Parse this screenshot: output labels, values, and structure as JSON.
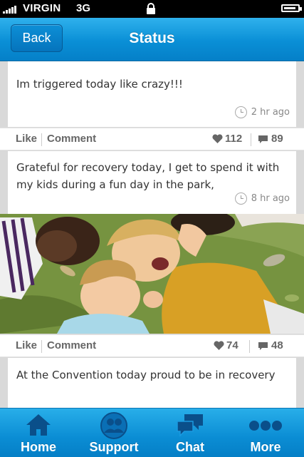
{
  "status_bar": {
    "carrier": "VIRGIN",
    "network": "3G",
    "battery_level": 0.9
  },
  "nav": {
    "back_label": "Back",
    "title": "Status"
  },
  "posts": [
    {
      "text": "Im triggered today like crazy!!!",
      "time": "2 hr ago",
      "like_label": "Like",
      "comment_label": "Comment",
      "likes": "112",
      "comments": "89"
    },
    {
      "text": "Grateful for recovery today, I get to spend it with my kids during a fun day in the park,",
      "time": "8 hr ago",
      "like_label": "Like",
      "comment_label": "Comment",
      "likes": "74",
      "comments": "48"
    },
    {
      "text": "At the Convention today proud to be in recovery"
    }
  ],
  "tabs": [
    {
      "label": "Home",
      "icon": "home-icon"
    },
    {
      "label": "Support",
      "icon": "support-group-icon"
    },
    {
      "label": "Chat",
      "icon": "chat-icon"
    },
    {
      "label": "More",
      "icon": "more-dots-icon"
    }
  ],
  "colors": {
    "accent": "#0a8fd6",
    "nav_dark": "#0574bd",
    "tab_icon": "#0a4f8a"
  }
}
